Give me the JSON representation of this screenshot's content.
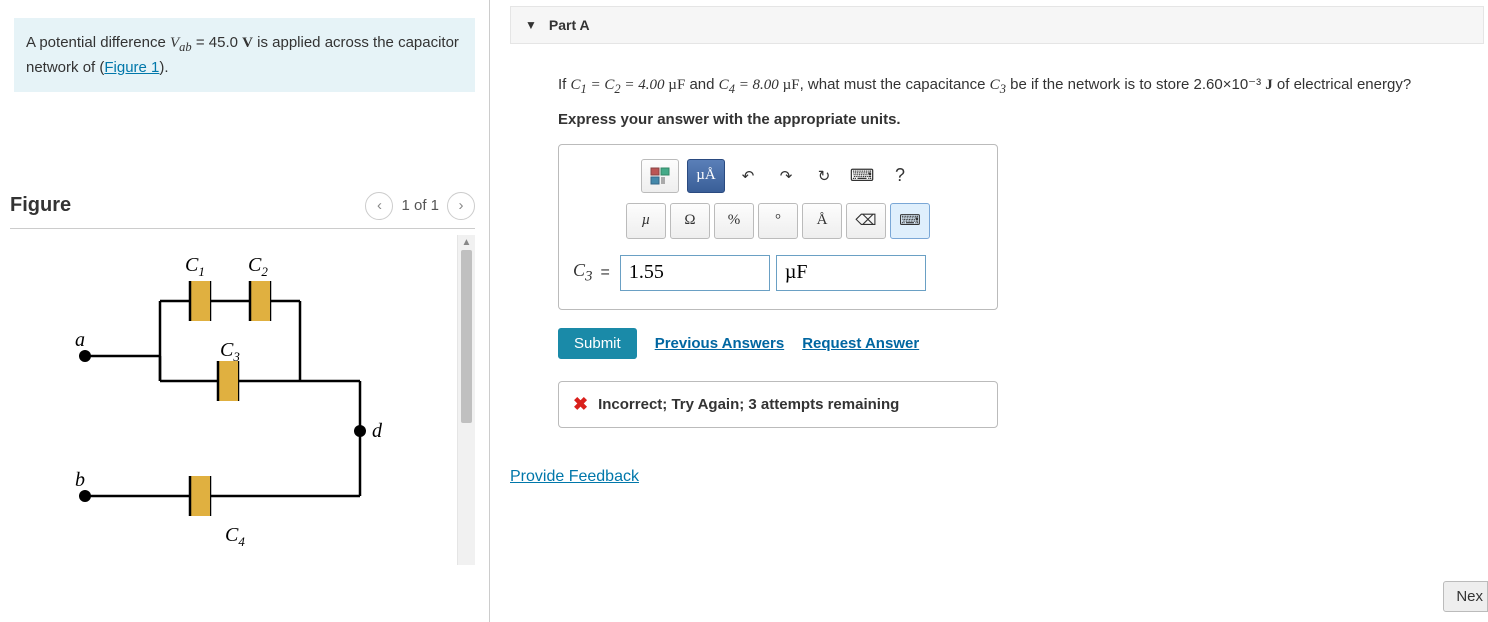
{
  "problem": {
    "pre_text": "A potential difference ",
    "var": "V",
    "var_sub": "ab",
    "value_text": " = 45.0 ",
    "unit": "V",
    "post_text": " is applied across the capacitor network of (",
    "figure_link": "Figure 1",
    "close": ")."
  },
  "figure": {
    "title": "Figure",
    "pager": "1 of 1",
    "labels": {
      "C1": "C",
      "C1s": "1",
      "C2": "C",
      "C2s": "2",
      "C3": "C",
      "C3s": "3",
      "C4": "C",
      "C4s": "4",
      "a": "a",
      "b": "b",
      "d": "d"
    }
  },
  "part": {
    "label": "Part A"
  },
  "question": {
    "pre": "If ",
    "c1c2": "C₁ = C₂ = 4.00 ",
    "uf1": "µF",
    "and": " and ",
    "c4": "C₄ = 8.00 ",
    "uf2": "µF",
    "mid": ", what must the capacitance ",
    "c3": "C₃",
    "post": " be if the network is to store 2.60×10⁻³ ",
    "j": "J",
    "tail": " of electrical energy?"
  },
  "instruct": "Express your answer with the appropriate units.",
  "toolbar": {
    "templates_icon": "▦",
    "units_label": "µÅ",
    "undo": "↶",
    "redo": "↷",
    "reset": "↻",
    "keyboard": "⌨",
    "help": "?",
    "row2": {
      "mu": "µ",
      "omega": "Ω",
      "percent": "%",
      "deg": "°",
      "angstrom": "Å",
      "backspace": "⌫",
      "kbd": "⌨"
    }
  },
  "answer": {
    "label": "C",
    "label_sub": "3",
    "eq": "=",
    "value": "1.55",
    "unit": "µF"
  },
  "actions": {
    "submit": "Submit",
    "previous": "Previous Answers",
    "request": "Request Answer"
  },
  "feedback": {
    "icon": "✖",
    "msg": "Incorrect; Try Again; 3 attempts remaining"
  },
  "links": {
    "provide": "Provide Feedback",
    "next": "Nex"
  }
}
